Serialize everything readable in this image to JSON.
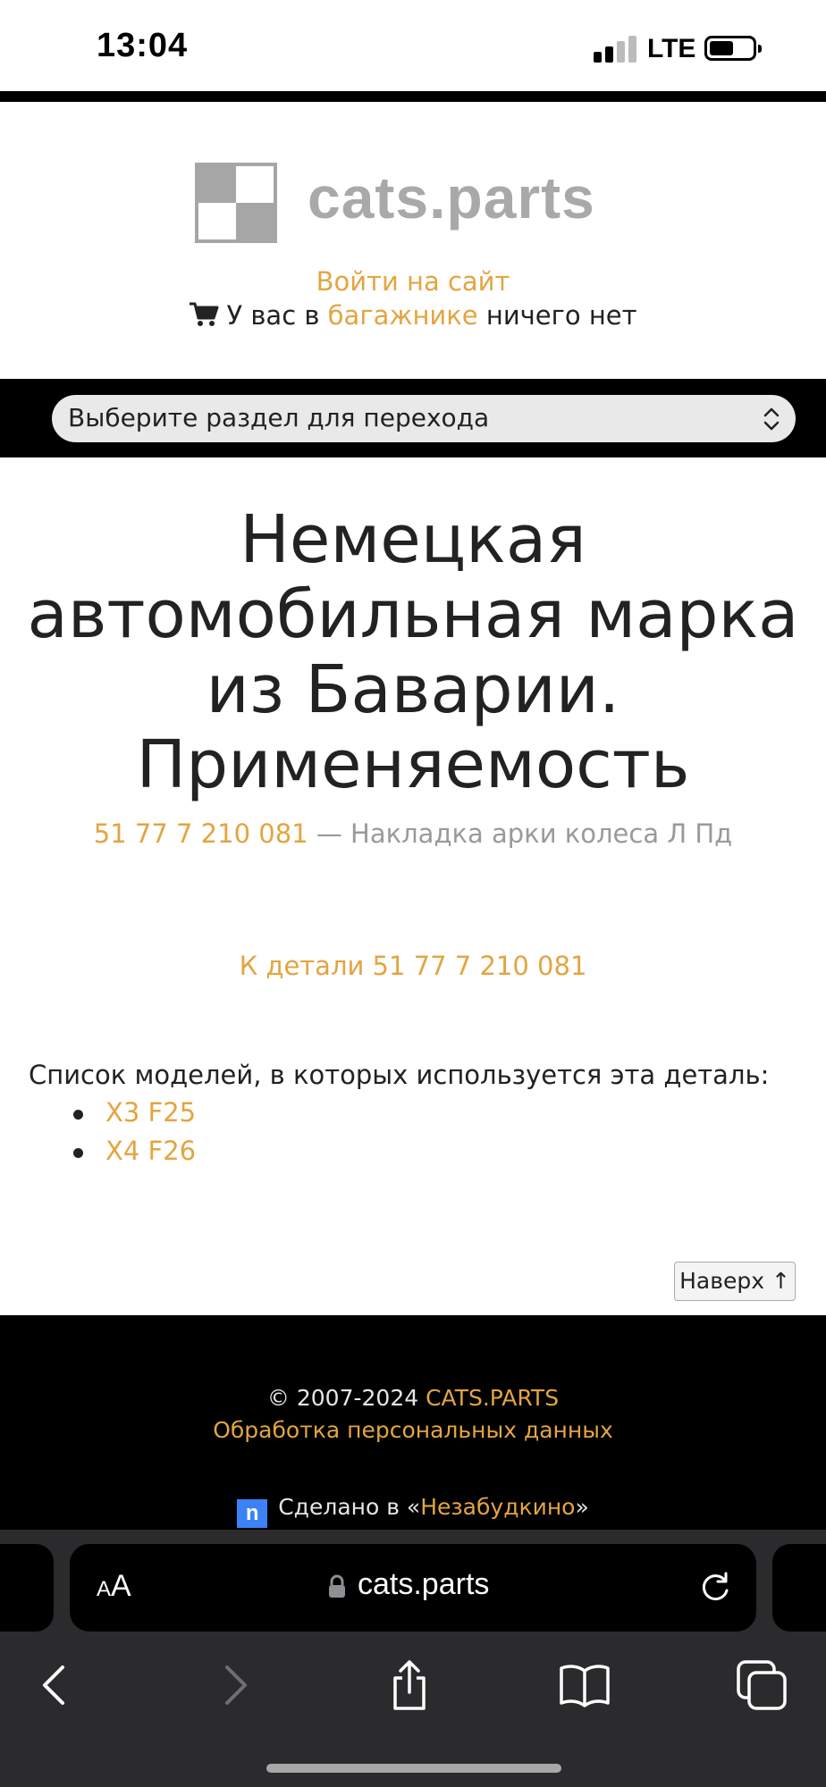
{
  "status_bar": {
    "time": "13:04",
    "network": "LTE"
  },
  "header": {
    "logo_text": "cats.parts",
    "login_link": "Войти на сайт",
    "cart_prefix": "У вас в ",
    "cart_link": "багажнике",
    "cart_suffix": " ничего нет"
  },
  "nav": {
    "select_value": "Выберите раздел для перехода"
  },
  "main": {
    "title": "Немецкая автомобильная марка из Баварии. Применяемость",
    "part_number": "51 77 7 210 081",
    "part_description": " — Накладка арки колеса Л Пд",
    "to_part_link": "К детали 51 77 7 210 081",
    "models_heading": "Список моделей, в которых используется эта деталь:",
    "models": [
      "X3 F25",
      "X4 F26"
    ],
    "top_button": "Наверх ↑"
  },
  "footer": {
    "copyright_prefix": "© 2007-2024 ",
    "copyright_link": "CATS.PARTS",
    "privacy_link": "Обработка персональных данных",
    "made_in_prefix": "Сделано в «",
    "made_in_link": "Незабудкино",
    "made_in_suffix": "»",
    "made_in_logo": "n"
  },
  "browser": {
    "aa_small": "A",
    "aa_large": "A",
    "url": "cats.parts"
  },
  "colors": {
    "accent": "#e3a541",
    "background": "#ffffff",
    "bars": "#000000",
    "browser_chrome": "#2b2b2d"
  },
  "icons": [
    "cart-icon",
    "chevron-updown-icon",
    "lock-icon",
    "reload-icon",
    "back-icon",
    "forward-icon",
    "share-icon",
    "bookmarks-icon",
    "tabs-icon"
  ]
}
